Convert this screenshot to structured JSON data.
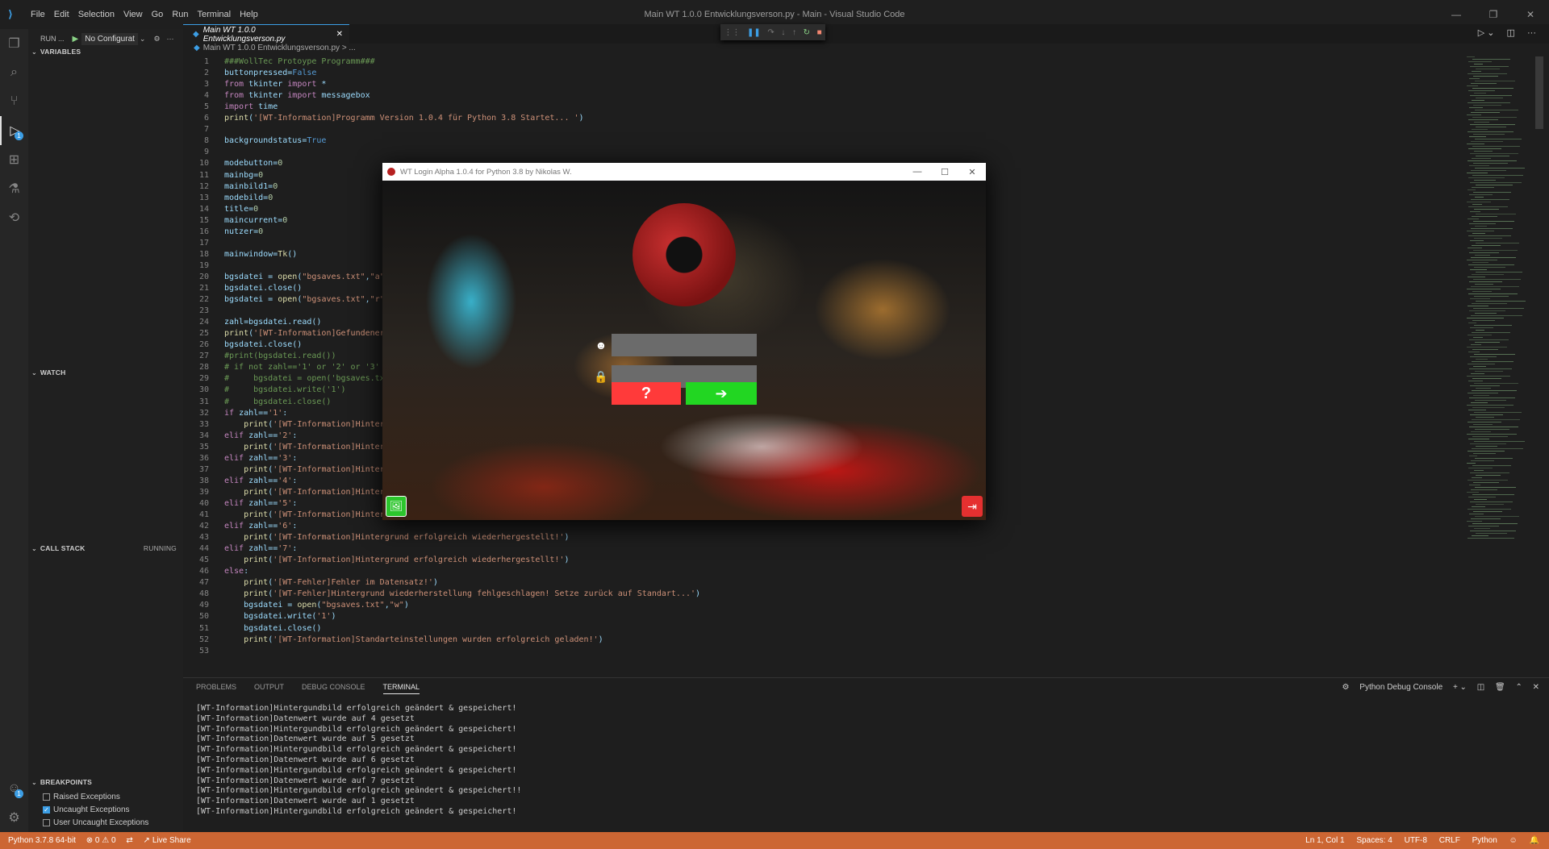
{
  "window": {
    "title": "Main WT 1.0.0 Entwicklungsverson.py - Main - Visual Studio Code",
    "menu": [
      "File",
      "Edit",
      "Selection",
      "View",
      "Go",
      "Run",
      "Terminal",
      "Help"
    ]
  },
  "sidebar": {
    "run_label": "RUN ...",
    "config": "No Configurat",
    "variables": "VARIABLES",
    "watch": "WATCH",
    "call_stack": "CALL STACK",
    "call_stack_status": "RUNNING",
    "breakpoints": "BREAKPOINTS",
    "breakpoint_items": [
      {
        "label": "Raised Exceptions",
        "checked": false
      },
      {
        "label": "Uncaught Exceptions",
        "checked": true
      },
      {
        "label": "User Uncaught Exceptions",
        "checked": false
      }
    ]
  },
  "editor": {
    "tab": "Main WT 1.0.0 Entwicklungsverson.py",
    "breadcrumb": "Main WT 1.0.0 Entwicklungsverson.py > ...",
    "lines": [
      "###WollTec Protoype Programm###",
      "buttonpressed=False",
      "from tkinter import *",
      "from tkinter import messagebox",
      "import time",
      "print('[WT-Information]Programm Version 1.0.4 für Python 3.8 Startet... ')",
      "",
      "backgroundstatus=True",
      "",
      "modebutton=0",
      "mainbg=0",
      "mainbild1=0",
      "modebild=0",
      "title=0",
      "maincurrent=0",
      "nutzer=0",
      "",
      "mainwindow=Tk()",
      "",
      "bgsdatei = open(\"bgsaves.txt\",\"a\")",
      "bgsdatei.close()",
      "bgsdatei = open(\"bgsaves.txt\",\"r\")",
      "",
      "zahl=bgsdatei.read()",
      "print('[WT-Information]Gefundener",
      "bgsdatei.close()",
      "#print(bgsdatei.read())",
      "# if not zahl=='1' or '2' or '3' o",
      "#     bgsdatei = open('bgsaves.txt",
      "#     bgsdatei.write('1')",
      "#     bgsdatei.close()",
      "if zahl=='1':",
      "    print('[WT-Information]Hintergr",
      "elif zahl=='2':",
      "    print('[WT-Information]Hintergr",
      "elif zahl=='3':",
      "    print('[WT-Information]Hintergr",
      "elif zahl=='4':",
      "    print('[WT-Information]Hintergr",
      "elif zahl=='5':",
      "    print('[WT-Information]Hintergrund erfolgreich wiederhergestellt!')",
      "elif zahl=='6':",
      "    print('[WT-Information]Hintergrund erfolgreich wiederhergestellt!')",
      "elif zahl=='7':",
      "    print('[WT-Information]Hintergrund erfolgreich wiederhergestellt!')",
      "else:",
      "    print('[WT-Fehler]Fehler im Datensatz!')",
      "    print('[WT-Fehler]Hintergrund wiederherstellung fehlgeschlagen! Setze zurück auf Standart...')",
      "    bgsdatei = open(\"bgsaves.txt\",\"w\")",
      "    bgsdatei.write('1')",
      "    bgsdatei.close()",
      "    print('[WT-Information]Standarteinstellungen wurden erfolgreich geladen!')",
      ""
    ]
  },
  "panel": {
    "tabs": [
      "PROBLEMS",
      "OUTPUT",
      "DEBUG CONSOLE",
      "TERMINAL"
    ],
    "active_tab": "TERMINAL",
    "console_label": "Python Debug Console",
    "terminal_lines": [
      "[WT-Information]Hintergundbild erfolgreich geändert & gespeichert!",
      "[WT-Information]Datenwert wurde auf 4 gesetzt",
      "[WT-Information]Hintergundbild erfolgreich geändert & gespeichert!",
      "[WT-Information]Datenwert wurde auf 5 gesetzt",
      "[WT-Information]Hintergundbild erfolgreich geändert & gespeichert!",
      "[WT-Information]Datenwert wurde auf 6 gesetzt",
      "[WT-Information]Hintergundbild erfolgreich geändert & gespeichert!",
      "[WT-Information]Datenwert wurde auf 7 gesetzt",
      "[WT-Information]Hintergundbild erfolgreich geändert & gespeichert!!",
      "[WT-Information]Datenwert wurde auf 1 gesetzt",
      "[WT-Information]Hintergundbild erfolgreich geändert & gespeichert!"
    ]
  },
  "status": {
    "python": "Python 3.7.8 64-bit",
    "problems": "⊗ 0 ⚠ 0",
    "live_share": "Live Share",
    "position": "Ln 1, Col 1",
    "spaces": "Spaces: 4",
    "encoding": "UTF-8",
    "eol": "CRLF",
    "language": "Python"
  },
  "login_window": {
    "title": "WT Login Alpha 1.0.4 for Python 3.8 by Nikolas W.",
    "help_symbol": "?",
    "go_symbol": "➔"
  },
  "colors": {
    "status_bar": "#cc6633",
    "help_button": "#ff3a3a",
    "login_button": "#22d622",
    "accent": "#3c9ee5"
  }
}
